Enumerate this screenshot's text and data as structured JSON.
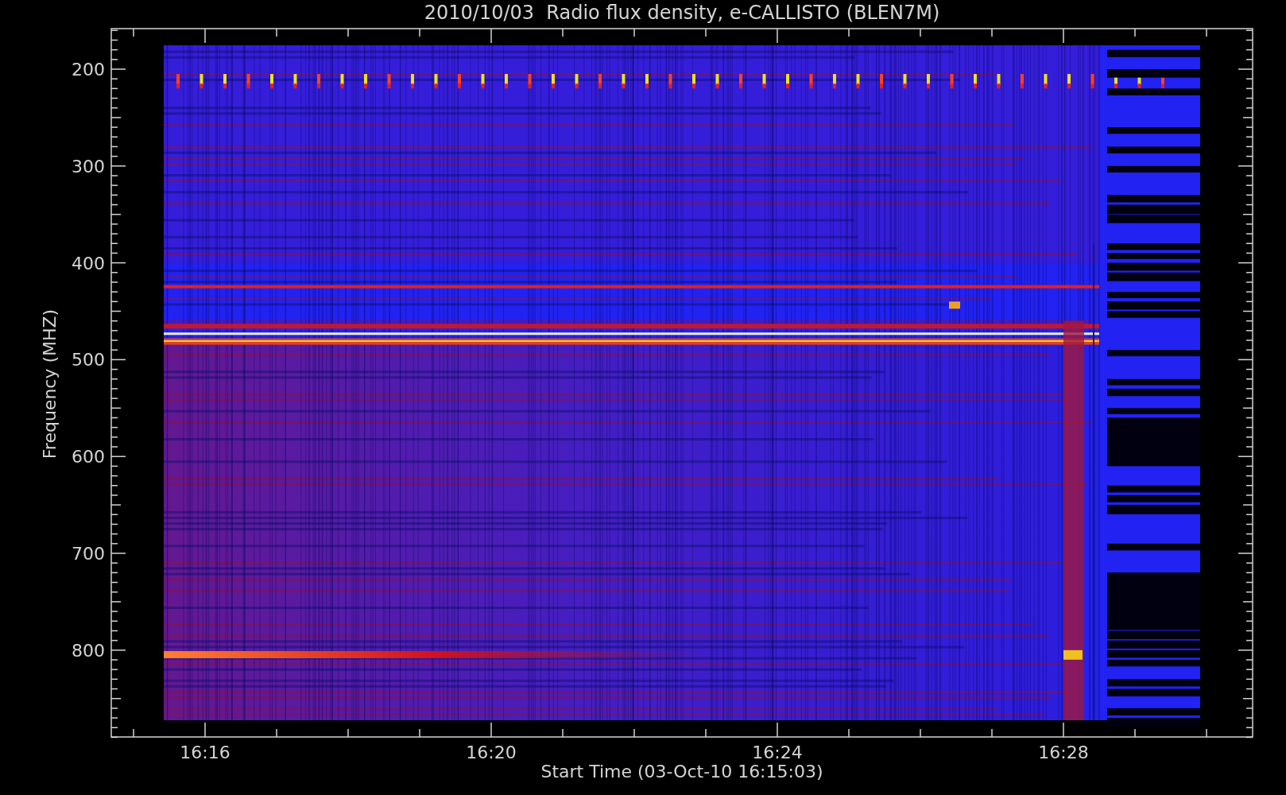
{
  "title": "2010/10/03  Radio flux density, e-CALLISTO (BLEN7M)",
  "y_axis": {
    "label": "Frequency (MHZ)",
    "ticks": [
      "200",
      "300",
      "400",
      "500",
      "600",
      "700",
      "800"
    ]
  },
  "x_axis": {
    "label": "Start Time (03-Oct-10 16:15:03)",
    "ticks": [
      "16:16",
      "16:20",
      "16:24",
      "16:28"
    ]
  }
}
